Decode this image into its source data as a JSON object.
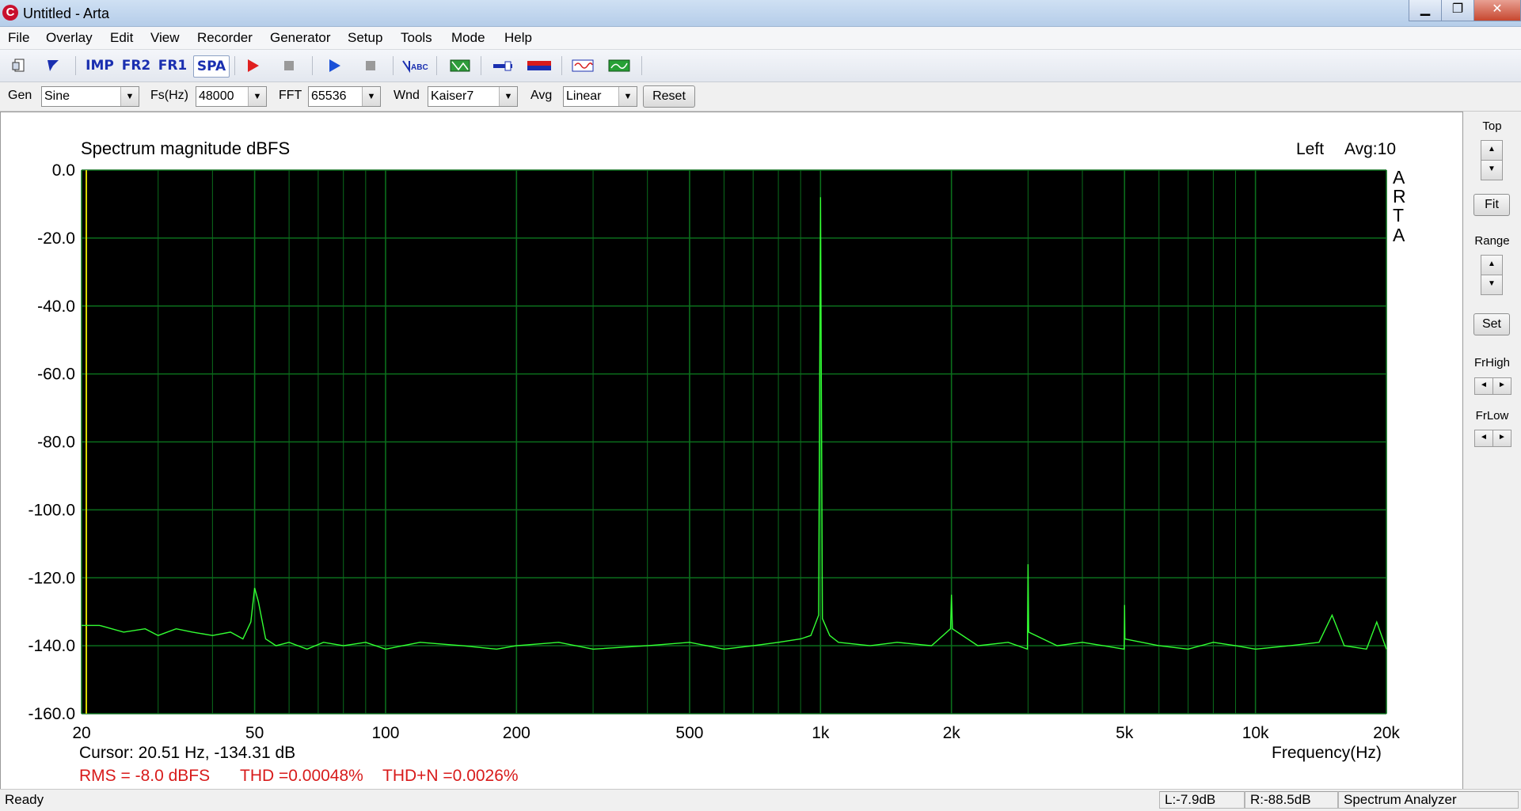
{
  "window": {
    "title": "Untitled - Arta",
    "app_icon_letter": "C",
    "minimize": "▁",
    "maximize": "❐",
    "close": "✕"
  },
  "menu": [
    "File",
    "Overlay",
    "Edit",
    "View",
    "Recorder",
    "Generator",
    "Setup",
    "Tools",
    "Mode",
    "Help"
  ],
  "toolbar": {
    "imp": "IMP",
    "fr2": "FR2",
    "fr1": "FR1",
    "spa": "SPA"
  },
  "controls": {
    "gen_label": "Gen",
    "gen_value": "Sine",
    "fs_label": "Fs(Hz)",
    "fs_value": "48000",
    "fft_label": "FFT",
    "fft_value": "65536",
    "wnd_label": "Wnd",
    "wnd_value": "Kaiser7",
    "avg_label": "Avg",
    "avg_value": "Linear",
    "reset": "Reset"
  },
  "plot": {
    "title": "Spectrum magnitude dBFS",
    "channel": "Left",
    "avg_info": "Avg:10",
    "brand": [
      "A",
      "R",
      "T",
      "A"
    ],
    "cursor": "Cursor: 20.51 Hz, -134.31 dB",
    "rms": "RMS =   -8.0 dBFS",
    "thd": "THD =0.00048%",
    "thdn": "THD+N =0.0026%"
  },
  "chart_data": {
    "type": "line",
    "title": "Spectrum magnitude dBFS",
    "xlabel": "Frequency(Hz)",
    "ylabel": "",
    "xscale": "log",
    "xlim": [
      20,
      20000
    ],
    "ylim": [
      -160,
      0
    ],
    "x_ticks": [
      {
        "v": 20,
        "label": "20"
      },
      {
        "v": 50,
        "label": "50"
      },
      {
        "v": 100,
        "label": "100"
      },
      {
        "v": 200,
        "label": "200"
      },
      {
        "v": 500,
        "label": "500"
      },
      {
        "v": 1000,
        "label": "1k"
      },
      {
        "v": 2000,
        "label": "2k"
      },
      {
        "v": 5000,
        "label": "5k"
      },
      {
        "v": 10000,
        "label": "10k"
      },
      {
        "v": 20000,
        "label": "20k"
      }
    ],
    "y_ticks": [
      {
        "v": 0,
        "label": "0.0"
      },
      {
        "v": -20,
        "label": "-20.0"
      },
      {
        "v": -40,
        "label": "-40.0"
      },
      {
        "v": -60,
        "label": "-60.0"
      },
      {
        "v": -80,
        "label": "-80.0"
      },
      {
        "v": -100,
        "label": "-100.0"
      },
      {
        "v": -120,
        "label": "-120.0"
      },
      {
        "v": -140,
        "label": "-140.0"
      },
      {
        "v": -160,
        "label": "-160.0"
      }
    ],
    "minor_grid_x": [
      30,
      40,
      60,
      70,
      80,
      90,
      300,
      400,
      600,
      700,
      800,
      900,
      3000,
      4000,
      6000,
      7000,
      8000,
      9000
    ],
    "grid": true,
    "colors": {
      "background": "#000000",
      "grid": "#0b6e1c",
      "trace": "#33ff33",
      "cursor": "#d8d800",
      "text": "#000000",
      "stats": "#d81b1b"
    },
    "series": [
      {
        "x": [
          20,
          22,
          25,
          28,
          30,
          33,
          36,
          40,
          44,
          47,
          49,
          50,
          51,
          53,
          56,
          60,
          66,
          72,
          80,
          90,
          100,
          120,
          150,
          180,
          200,
          250,
          300,
          400,
          500,
          600,
          700,
          800,
          900,
          950,
          990,
          1000,
          1010,
          1050,
          1100,
          1300,
          1500,
          1800,
          1990,
          2000,
          2010,
          2300,
          2700,
          2990,
          3000,
          3010,
          3500,
          4000,
          4990,
          5000,
          5010,
          6000,
          7000,
          8000,
          9000,
          10000,
          12000,
          14000,
          15000,
          16000,
          18000,
          19000,
          20000
        ],
        "y": [
          -134,
          -134,
          -136,
          -135,
          -137,
          -135,
          -136,
          -137,
          -136,
          -138,
          -133,
          -123,
          -127,
          -138,
          -140,
          -139,
          -141,
          -139,
          -140,
          -139,
          -141,
          -139,
          -140,
          -141,
          -140,
          -139,
          -141,
          -140,
          -139,
          -141,
          -140,
          -139,
          -138,
          -137,
          -131,
          -8,
          -132,
          -137,
          -139,
          -140,
          -139,
          -140,
          -135,
          -125,
          -135,
          -140,
          -139,
          -141,
          -116,
          -136,
          -140,
          -139,
          -141,
          -128,
          -138,
          -140,
          -141,
          -139,
          -140,
          -141,
          -140,
          -139,
          -131,
          -140,
          -141,
          -133,
          -141
        ]
      }
    ]
  },
  "right_panel": {
    "top": "Top",
    "fit": "Fit",
    "range": "Range",
    "set": "Set",
    "frhigh": "FrHigh",
    "frlow": "FrLow",
    "up": "▲",
    "down": "▼",
    "left": "◄",
    "right": "►"
  },
  "status": {
    "ready": "Ready",
    "left": "L:-7.9dB",
    "right": "R:-88.5dB",
    "mode": "Spectrum Analyzer"
  }
}
